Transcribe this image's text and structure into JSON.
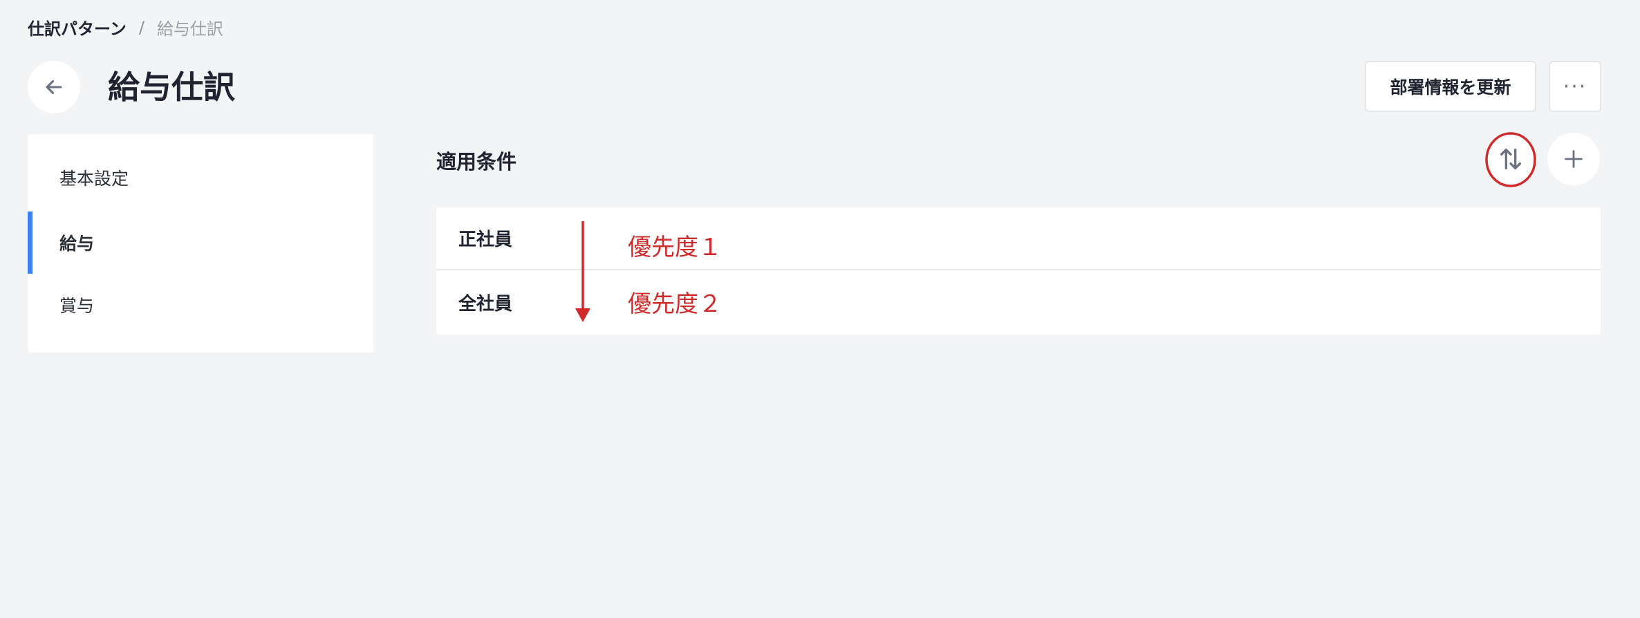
{
  "breadcrumb": {
    "parent": "仕訳パターン",
    "separator": "/",
    "current": "給与仕訳"
  },
  "page": {
    "title": "給与仕訳"
  },
  "header_actions": {
    "update_label": "部署情報を更新",
    "more_label": "···"
  },
  "sidebar": {
    "items": [
      {
        "label": "基本設定",
        "active": false
      },
      {
        "label": "給与",
        "active": true
      },
      {
        "label": "賞与",
        "active": false
      }
    ]
  },
  "section": {
    "title": "適用条件"
  },
  "conditions": {
    "rows": [
      {
        "label": "正社員"
      },
      {
        "label": "全社員"
      }
    ]
  },
  "annotations": {
    "priority_1": "優先度１",
    "priority_2": "優先度２"
  },
  "colors": {
    "background": "#f3f4f6",
    "accent": "#3b82f6",
    "annotation": "#d02b2b"
  },
  "icons": {
    "back": "arrow-left-icon",
    "sort": "sort-arrows-icon",
    "add": "plus-icon",
    "more": "ellipsis-icon"
  }
}
